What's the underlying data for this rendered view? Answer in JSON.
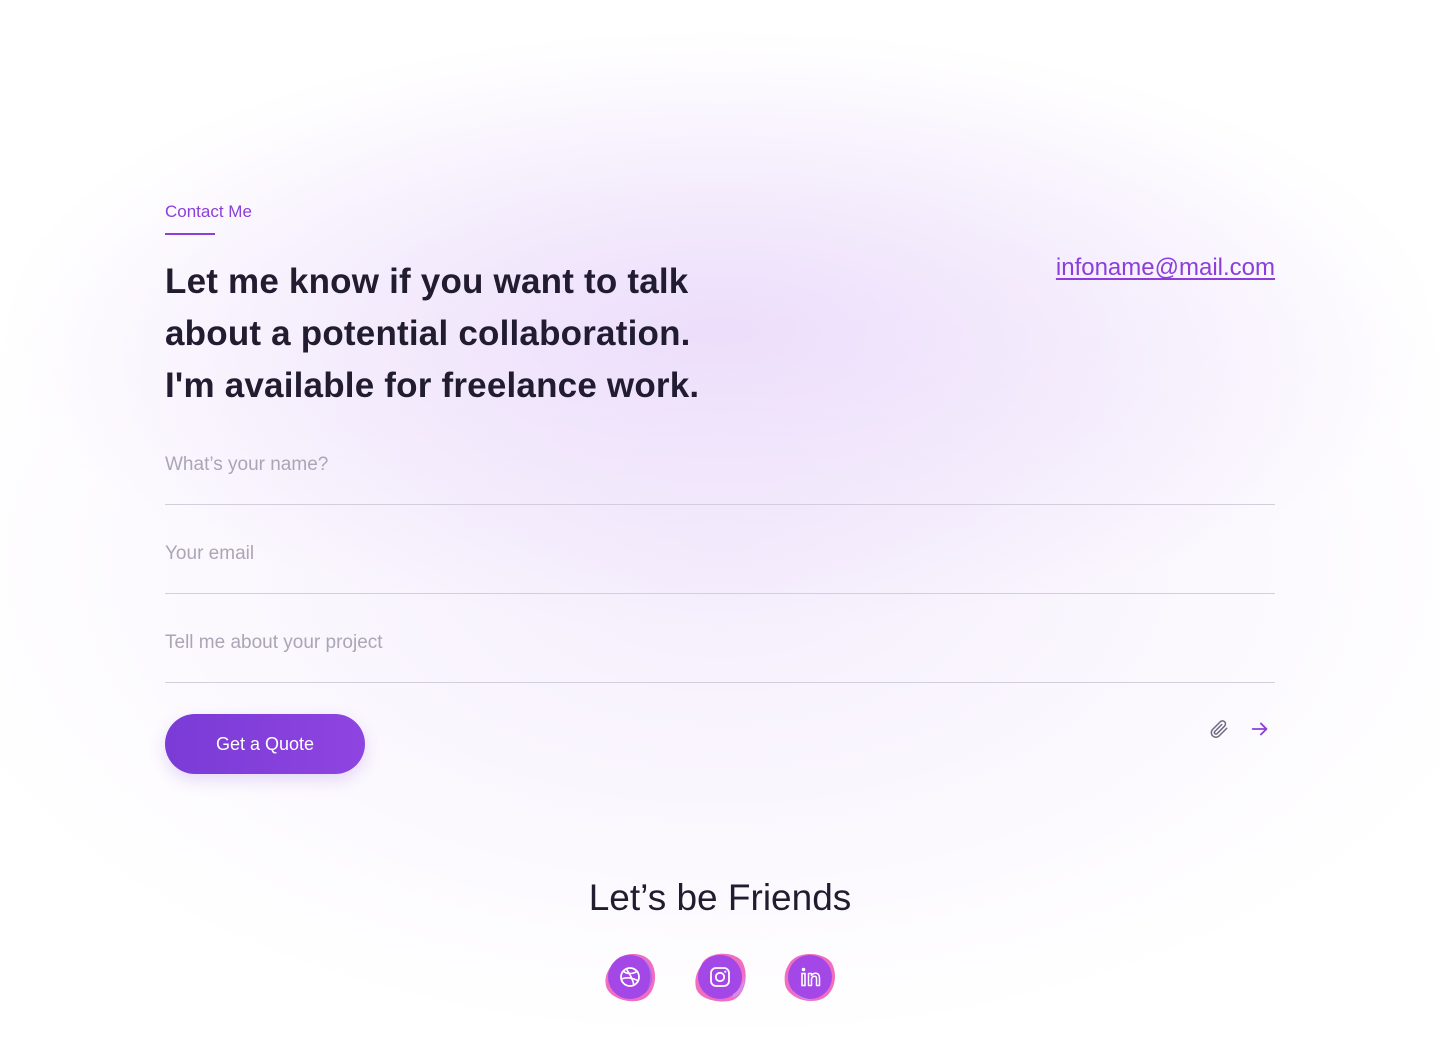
{
  "contact": {
    "eyebrow": "Contact Me",
    "headline": [
      "Let me know if you want to talk",
      "about a potential collaboration.",
      "I'm available for freelance work."
    ],
    "email": "infoname@mail.com"
  },
  "form": {
    "name_placeholder": "What’s your name?",
    "email_placeholder": "Your email",
    "project_placeholder": "Tell me about your project",
    "submit_label": "Get a Quote",
    "icons": {
      "attach": "paperclip-icon",
      "send": "arrow-right-icon"
    }
  },
  "friends": {
    "title": "Let’s be Friends",
    "socials": [
      {
        "icon": "dribbble-icon"
      },
      {
        "icon": "instagram-icon"
      },
      {
        "icon": "linkedin-icon"
      }
    ]
  },
  "colors": {
    "accent": "#8b3fd9",
    "button": "#7c3ed8",
    "text": "#211c30",
    "placeholder": "#aba5b6",
    "divider": "#d3cedb",
    "social_pink": "#f06ec0",
    "social_purple": "#a347e6"
  }
}
